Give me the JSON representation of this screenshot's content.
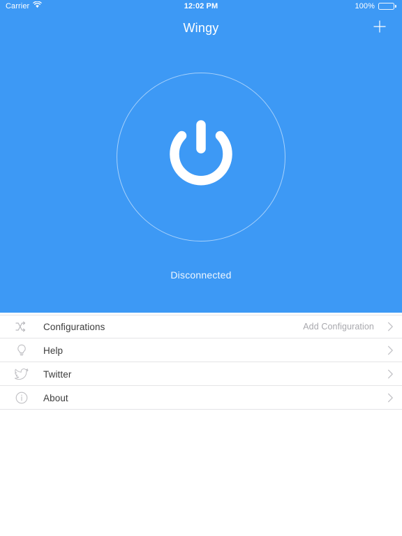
{
  "theme": {
    "accent": "#3d99f5",
    "nav_text": "#ffffff",
    "row_label": "#3c3c3c",
    "row_detail": "#a8a8ad",
    "separator": "#e4e4e6",
    "ring_stroke": "rgba(255,255,255,0.55)"
  },
  "status_bar": {
    "carrier": "Carrier",
    "wifi_icon": "wifi-icon",
    "time": "12:02 PM",
    "battery_percent": "100%",
    "battery_icon": "battery-full-icon"
  },
  "nav": {
    "title": "Wingy",
    "add_icon": "plus-icon"
  },
  "hero": {
    "power_icon": "power-icon",
    "status_label": "Disconnected"
  },
  "list": {
    "rows": [
      {
        "icon": "shuffle-icon",
        "label": "Configurations",
        "detail": "Add Configuration",
        "chevron": "chevron-right-icon"
      },
      {
        "icon": "lightbulb-icon",
        "label": "Help",
        "detail": "",
        "chevron": "chevron-right-icon"
      },
      {
        "icon": "twitter-bird-icon",
        "label": "Twitter",
        "detail": "",
        "chevron": "chevron-right-icon"
      },
      {
        "icon": "info-circle-icon",
        "label": "About",
        "detail": "",
        "chevron": "chevron-right-icon"
      }
    ]
  }
}
